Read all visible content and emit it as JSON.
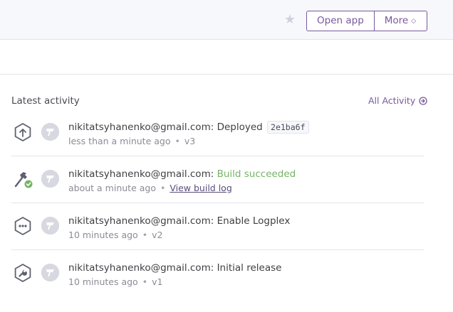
{
  "header": {
    "star_icon": "star-icon",
    "open_app_label": "Open app",
    "more_label": "More"
  },
  "activity": {
    "title": "Latest activity",
    "all_activity_label": "All Activity",
    "items": [
      {
        "icon": "deploy-icon",
        "user": "nikitatsyhanenko@gmail.com:",
        "action": "Deployed",
        "commit": "2e1ba6f",
        "time": "less than a minute ago",
        "version": "v3"
      },
      {
        "icon": "build-success-icon",
        "user": "nikitatsyhanenko@gmail.com:",
        "action": "Build succeeded",
        "time": "about a minute ago",
        "link": "View build log"
      },
      {
        "icon": "addon-icon",
        "user": "nikitatsyhanenko@gmail.com:",
        "action": "Enable Logplex",
        "time": "10 minutes ago",
        "version": "v2"
      },
      {
        "icon": "release-icon",
        "user": "nikitatsyhanenko@gmail.com:",
        "action": "Initial release",
        "time": "10 minutes ago",
        "version": "v1"
      }
    ]
  },
  "colors": {
    "accent": "#79589f",
    "success": "#74b566",
    "muted": "#8b8b96"
  }
}
